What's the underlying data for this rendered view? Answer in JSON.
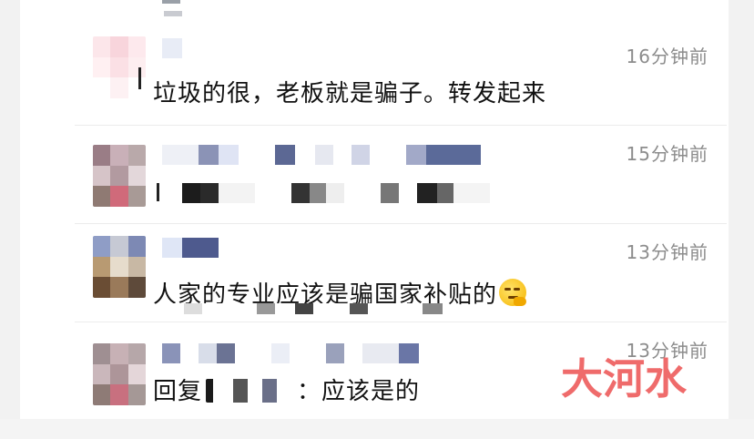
{
  "comments": [
    {
      "time": "16分钟前",
      "content": "垃圾的很，老板就是骗子。转发起来",
      "has_emoji": false
    },
    {
      "time": "15分钟前",
      "content": "",
      "has_emoji": false
    },
    {
      "time": "13分钟前",
      "content": "人家的专业应该是骗国家补贴的",
      "has_emoji": true,
      "emoji_icon": "thinking-face-icon"
    },
    {
      "time": "13分钟前",
      "reply_prefix": "回复",
      "reply_suffix": "：应该是的"
    }
  ],
  "watermark": {
    "text": "大河水",
    "color": "#ef6b6b"
  },
  "colors": {
    "time": "#8c8c8c",
    "text": "#111111",
    "divider": "#ececec"
  }
}
